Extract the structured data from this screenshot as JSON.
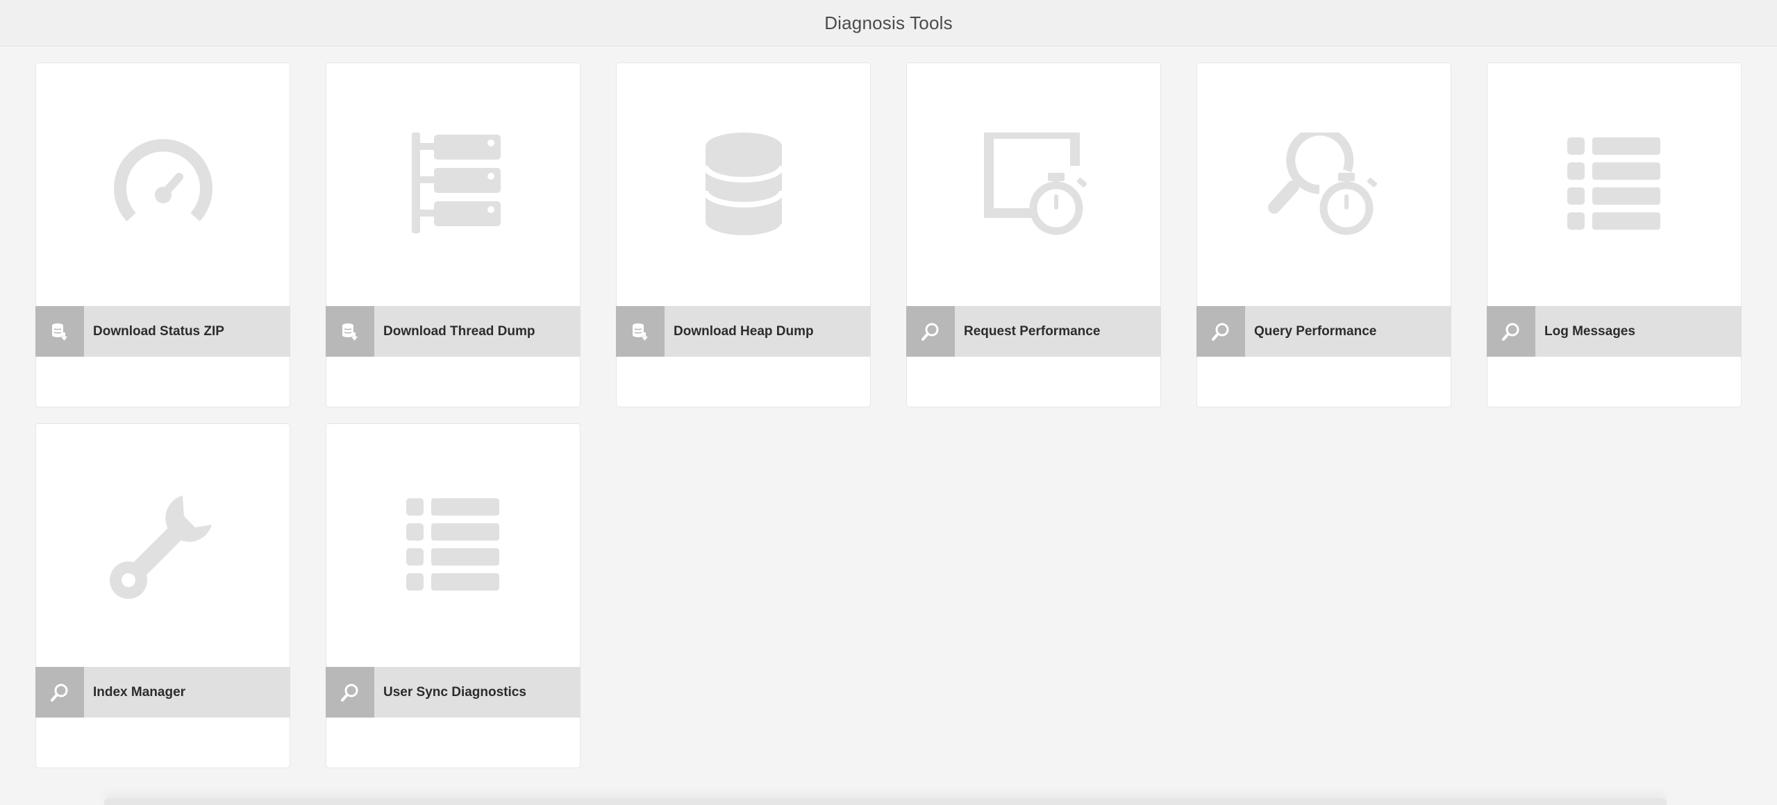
{
  "header": {
    "title": "Diagnosis Tools"
  },
  "colors": {
    "page_bg": "#f4f4f4",
    "card_bg": "#ffffff",
    "bar_bg": "#e0e0e0",
    "bar_icon_bg": "#b8b8b8",
    "art_gray": "#e0e0e0"
  },
  "cards": [
    {
      "label": "Download Status ZIP",
      "art_icon": "speedometer-icon",
      "bar_icon": "download-database-icon"
    },
    {
      "label": "Download Thread Dump",
      "art_icon": "thread-tree-icon",
      "bar_icon": "download-database-icon"
    },
    {
      "label": "Download Heap Dump",
      "art_icon": "database-icon",
      "bar_icon": "download-database-icon"
    },
    {
      "label": "Request Performance",
      "art_icon": "window-stopwatch-icon",
      "bar_icon": "search-icon"
    },
    {
      "label": "Query Performance",
      "art_icon": "search-stopwatch-icon",
      "bar_icon": "search-icon"
    },
    {
      "label": "Log Messages",
      "art_icon": "list-icon",
      "bar_icon": "search-icon"
    },
    {
      "label": "Index Manager",
      "art_icon": "wrench-icon",
      "bar_icon": "search-icon"
    },
    {
      "label": "User Sync Diagnostics",
      "art_icon": "list-icon",
      "bar_icon": "search-icon"
    }
  ]
}
